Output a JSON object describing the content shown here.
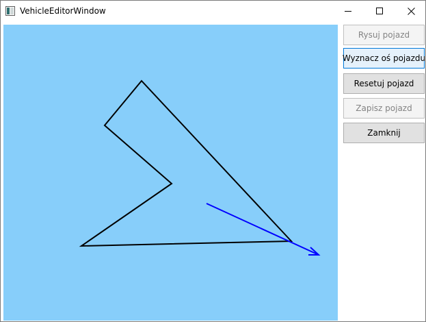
{
  "window": {
    "title": "VehicleEditorWindow",
    "icon": "app-window-icon"
  },
  "caption_buttons": {
    "minimize": "minimize-icon",
    "maximize": "maximize-icon",
    "close": "close-icon"
  },
  "canvas": {
    "background_color": "#87cefa",
    "vehicle_outline_color": "#000000",
    "axis_arrow_color": "#0000ff"
  },
  "buttons": {
    "rysuj_pojazd": {
      "label": "Rysuj pojazd",
      "enabled": false
    },
    "wyznacz_os_pojazdu": {
      "label": "Wyznacz oś pojazdu",
      "enabled": true,
      "focused": true
    },
    "resetuj_pojazd": {
      "label": "Resetuj pojazd",
      "enabled": true
    },
    "zapisz_pojazd": {
      "label": "Zapisz pojazd",
      "enabled": false
    },
    "zamknij": {
      "label": "Zamknij",
      "enabled": true
    }
  }
}
